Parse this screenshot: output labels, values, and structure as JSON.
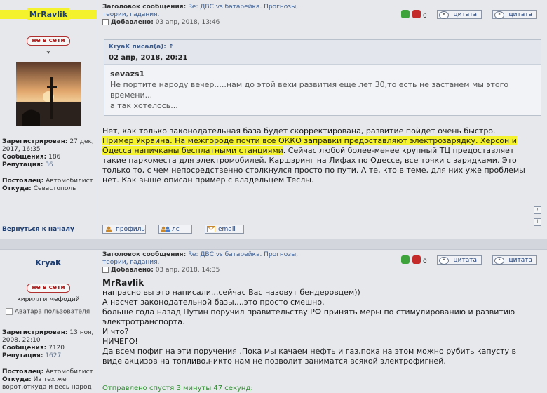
{
  "post1": {
    "username": "MrRavlik",
    "status": "не в сети",
    "star": "*",
    "avatar_caption": "",
    "registered_label": "Зарегистрирован:",
    "registered_value": "27 дек, 2017, 16:35",
    "messages_label": "Сообщения:",
    "messages_value": "186",
    "reputation_label": "Репутация:",
    "reputation_value": "36",
    "regular_label": "Постоялец:",
    "regular_value": "Автомобилист",
    "from_label": "Откуда:",
    "from_value": "Севастополь",
    "subject_label": "Заголовок сообщения:",
    "subject_value": "Re: ДВС vs батарейка. Прогнозы, теории, гадания.",
    "added_label": "Добавлено:",
    "added_value": "03 апр, 2018, 13:46",
    "rating_count": "0",
    "quote_btn_1": "цитата",
    "quote_btn_2": "цитата",
    "quote": {
      "author": "KryaK писал(а): ↑",
      "date": "02 апр, 2018, 20:21",
      "name": "sevazs1",
      "lines": [
        "Не портите народу вечер.....нам до этой вехи развития еще лет 30,то есть не застанем мы этого",
        "времени...",
        "а так хотелось..."
      ]
    },
    "body": {
      "line1": "Нет, как только законодательная база будет скорректирована, развитие пойдёт очень быстро.",
      "hl_a": "Пример Украина. На межгороде почти все ОККО заправки предоставляют электрозарядку. Херсон и",
      "hl_b": "Одесса напичканы бесплатными станциями",
      "line3_rest": ". Сейчас любой более-менее крупный ТЦ предоставляет",
      "line4": "такие паркоместа для электромобилей. Каршэринг на Лифах по Одессе, все точки с зарядками. Это",
      "line5": "только то, с чем непосредственно столкнулся просто по пути. А те, кто в теме, для них уже проблемы",
      "line6": "нет. Как выше описан пример с владельцем Теслы."
    },
    "back_to_top": "Вернуться к началу",
    "profile_btn": "профиль",
    "pm_btn": "лс",
    "email_btn": "email"
  },
  "post2": {
    "username": "KryaK",
    "status": "не в сети",
    "user_title": "кирилл и мефодий",
    "avatar_alt": "Аватара пользователя",
    "registered_label": "Зарегистрирован:",
    "registered_value": "13 ноя, 2008, 22:10",
    "messages_label": "Сообщения:",
    "messages_value": "7120",
    "reputation_label": "Репутация:",
    "reputation_value": "1627",
    "regular_label": "Постоялец:",
    "regular_value": "Автомобилист",
    "from_label": "Откуда:",
    "from_value": "Из тех же ворот,откуда и весь народ",
    "subject_label": "Заголовок сообщения:",
    "subject_value": "Re: ДВС vs батарейка. Прогнозы, теории, гадания.",
    "added_label": "Добавлено:",
    "added_value": "03 апр, 2018, 14:35",
    "rating_count": "0",
    "quote_btn_1": "цитата",
    "quote_btn_2": "цитата",
    "body_name": "MrRavlik",
    "body_lines": [
      "напрасно вы это написали...сейчас Вас назовут бендеровцем))",
      "А насчет законодательной базы....это просто смешно.",
      "больше года назад Путин поручил правительству РФ принять меры по стимулированию и развитию",
      "электротранспорта.",
      "И что?",
      "НИЧЕГО!",
      "Да всем пофиг на эти поручения .Пока мы качаем нефть и газ,пока на этом можно рубить капусту в",
      "виде акцизов на топливо,никто нам не позволит заниматся всякой электрофигней."
    ],
    "sent_after": "Отправлено спустя 3 минуты 47 секунд:"
  },
  "colors": {
    "accent": "#1b3d73",
    "highlight": "#f4f22c",
    "offline": "#b02020"
  }
}
